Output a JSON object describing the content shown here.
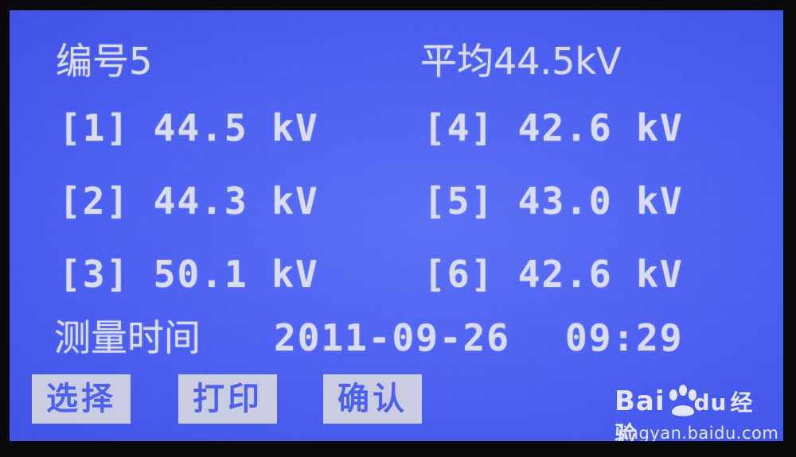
{
  "header": {
    "number_label": "编号5",
    "average_label": "平均44.5kV"
  },
  "readings": [
    {
      "index": "[1]",
      "value": "44.5",
      "unit": "kV"
    },
    {
      "index": "[2]",
      "value": "44.3",
      "unit": "kV"
    },
    {
      "index": "[3]",
      "value": "50.1",
      "unit": "kV"
    },
    {
      "index": "[4]",
      "value": "42.6",
      "unit": "kV"
    },
    {
      "index": "[5]",
      "value": "43.0",
      "unit": "kV"
    },
    {
      "index": "[6]",
      "value": "42.6",
      "unit": "kV"
    }
  ],
  "measurement": {
    "label": "测量时间",
    "date": "2011-09-26",
    "time": "09:29"
  },
  "softkeys": {
    "select": "选择",
    "print": "打印",
    "confirm": "确认"
  },
  "watermark": {
    "brand_left": "Bai",
    "brand_du": "du",
    "brand_right": "经验",
    "url": "jingyan.baidu.com"
  },
  "colors": {
    "screen_blue": "#4a5ef0",
    "text": "#d9dcf0",
    "bezel": "#0a0a0c"
  }
}
